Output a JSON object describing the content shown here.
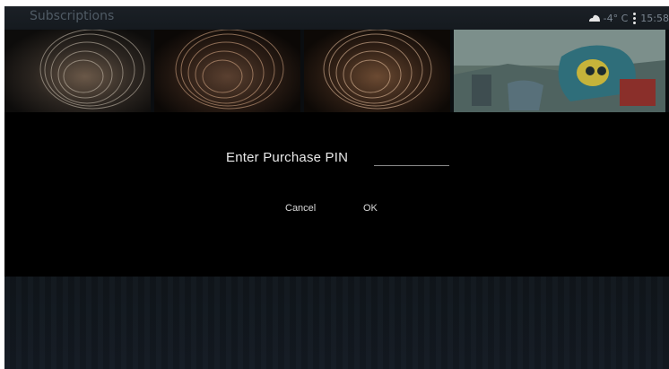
{
  "header": {
    "title": "Subscriptions",
    "weather_icon": "cloud-icon",
    "temperature": "-4° C",
    "menu_icon": "vertical-dots-icon",
    "time": "15:58"
  },
  "tiles": [
    {
      "name": "swirl-thumbnail"
    },
    {
      "name": "swirl-thumbnail"
    },
    {
      "name": "swirl-thumbnail"
    },
    {
      "name": "cartoon-thumbnail"
    }
  ],
  "dialog": {
    "prompt": "Enter Purchase PIN",
    "pin_value": "",
    "cancel_label": "Cancel",
    "ok_label": "OK"
  },
  "colors": {
    "background": "#0a0d10",
    "dialog": "#000000",
    "text": "#e8e8e8"
  }
}
